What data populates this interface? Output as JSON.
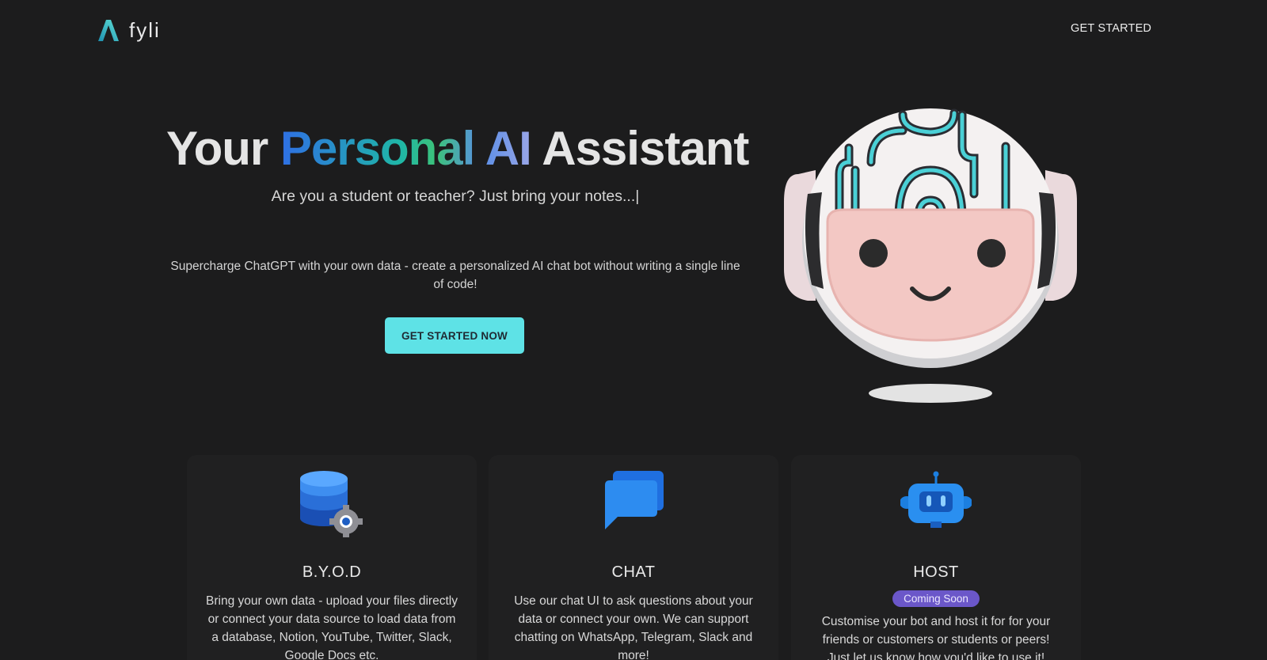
{
  "brand": {
    "name": "fyli"
  },
  "nav": {
    "cta_label": "GET STARTED"
  },
  "hero": {
    "title_start": "Your",
    "title_highlight": "Personal AI",
    "title_end": "Assistant",
    "subtitle": "Are you a student or teacher? Just bring your notes...|",
    "description": "Supercharge ChatGPT with your own data - create a personalized AI chat bot without writing a single line of code!",
    "cta_label": "GET STARTED NOW"
  },
  "features": [
    {
      "title": "B.Y.O.D",
      "icon": "database-gear-icon",
      "description": "Bring your own data - upload your files directly or connect your data source to load data from a database, Notion, YouTube, Twitter, Slack, Google Docs etc."
    },
    {
      "title": "CHAT",
      "icon": "chat-bubbles-icon",
      "description": "Use our chat UI to ask questions about your data or connect your own. We can support chatting on WhatsApp, Telegram, Slack and more!"
    },
    {
      "title": "HOST",
      "icon": "robot-icon",
      "badge": "Coming Soon",
      "description": "Customise your bot and host it for for your friends or customers or students or peers! Just let us know how you'd like to use it!"
    }
  ],
  "colors": {
    "background": "#1c1c1d",
    "card": "#202021",
    "accent": "#5ee2e6",
    "badge": "#6b57c9"
  }
}
